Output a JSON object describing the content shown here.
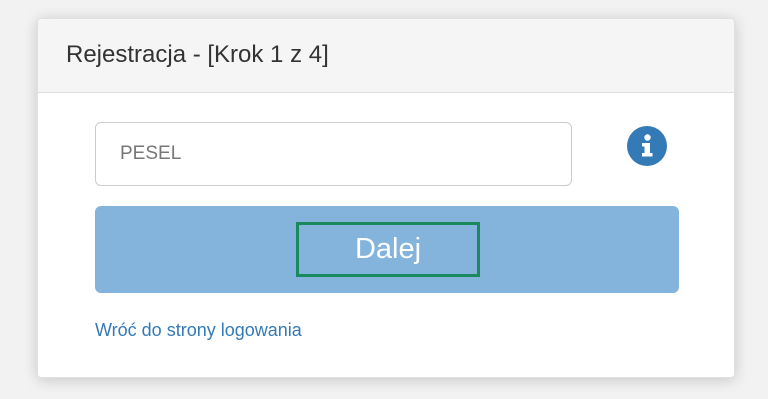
{
  "panel": {
    "title": "Rejestracja - [Krok 1 z 4]"
  },
  "form": {
    "pesel_placeholder": "PESEL",
    "pesel_value": "",
    "info_icon": "info-circle",
    "next_label": "Dalej",
    "back_link": "Wróć do strony logowania"
  },
  "colors": {
    "button": "#84b4dc",
    "focus_outline": "#1a8a5e",
    "link": "#337ab7",
    "info_icon": "#337ab7"
  }
}
